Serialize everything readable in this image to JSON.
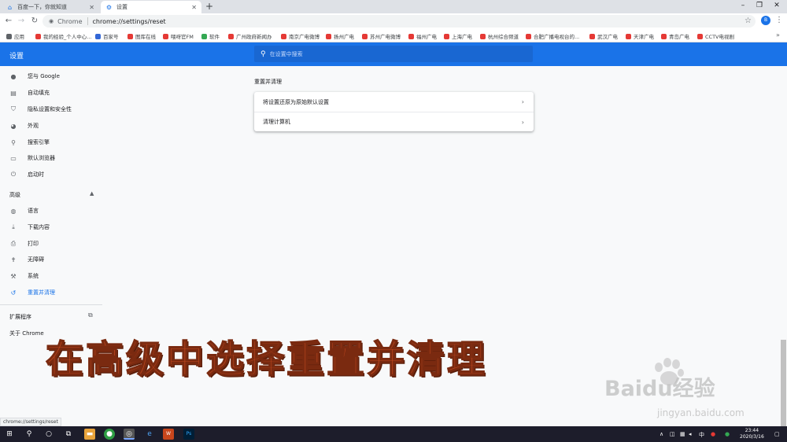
{
  "tabs": [
    {
      "label": "百度一下，你就知道"
    },
    {
      "label": "设置"
    }
  ],
  "toolbar": {
    "chip": "Chrome",
    "url": "chrome://settings/reset",
    "avatar": "B"
  },
  "bookmarks": [
    {
      "label": "应用",
      "color": "#5f6368"
    },
    {
      "label": "我的经验_个人中心...",
      "color": "#e53935"
    },
    {
      "label": "百家号",
      "color": "#3367d6"
    },
    {
      "label": "图库在线",
      "color": "#e53935"
    },
    {
      "label": "喂呀官FM",
      "color": "#e53935"
    },
    {
      "label": "软件",
      "color": "#34a853"
    },
    {
      "label": "广州政府新闻办",
      "color": "#e53935"
    },
    {
      "label": "南京广电微博",
      "color": "#e53935"
    },
    {
      "label": "扬州广电",
      "color": "#e53935"
    },
    {
      "label": "苏州广电微博",
      "color": "#e53935"
    },
    {
      "label": "福州广电",
      "color": "#e53935"
    },
    {
      "label": "上海广电",
      "color": "#e53935"
    },
    {
      "label": "杭州综合频道",
      "color": "#e53935"
    },
    {
      "label": "合肥广播电视台的...",
      "color": "#e53935"
    },
    {
      "label": "武汉广电",
      "color": "#e53935"
    },
    {
      "label": "天津广电",
      "color": "#e53935"
    },
    {
      "label": "青岛广电",
      "color": "#e53935"
    },
    {
      "label": "CCTV电视剧",
      "color": "#e53935"
    }
  ],
  "header": {
    "title": "设置",
    "search_placeholder": "在设置中搜索"
  },
  "sidebar": {
    "items": [
      {
        "label": "您与 Google",
        "icon": "person-icon"
      },
      {
        "label": "自动填充",
        "icon": "clipboard-icon"
      },
      {
        "label": "隐私设置和安全性",
        "icon": "shield-icon"
      },
      {
        "label": "外观",
        "icon": "palette-icon"
      },
      {
        "label": "搜索引擎",
        "icon": "search-icon"
      },
      {
        "label": "默认浏览器",
        "icon": "browser-icon"
      },
      {
        "label": "启动时",
        "icon": "power-icon"
      }
    ],
    "advanced_label": "高级",
    "advanced_items": [
      {
        "label": "语言",
        "icon": "globe-icon"
      },
      {
        "label": "下载内容",
        "icon": "download-icon"
      },
      {
        "label": "打印",
        "icon": "printer-icon"
      },
      {
        "label": "无障碍",
        "icon": "accessibility-icon"
      },
      {
        "label": "系统",
        "icon": "wrench-icon"
      },
      {
        "label": "重置并清理",
        "icon": "restore-icon"
      }
    ],
    "extensions_label": "扩展程序",
    "about_label": "关于 Chrome"
  },
  "main": {
    "section_title": "重置并清理",
    "rows": [
      {
        "label": "将设置还原为原始默认设置"
      },
      {
        "label": "清理计算机"
      }
    ]
  },
  "overlay": {
    "caption": "在高级中选择重置并清理",
    "watermark": "Baidu经验",
    "watermark_url": "jingyan.baidu.com"
  },
  "status_url": "chrome://settings/reset",
  "taskbar": {
    "time": "23:44",
    "date": "2020/3/16",
    "ime": "中"
  },
  "colors": {
    "accent": "#1a73e8",
    "caption": "#c0471e"
  }
}
